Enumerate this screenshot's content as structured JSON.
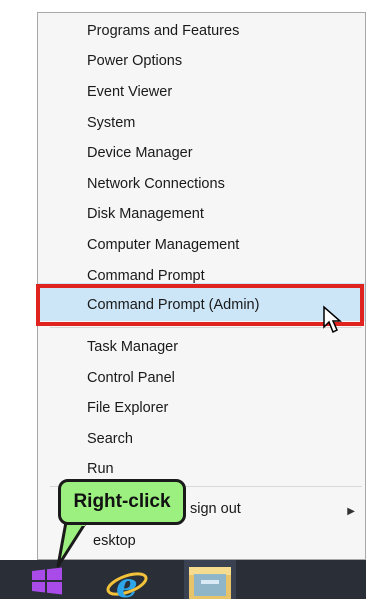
{
  "menu": {
    "items": [
      {
        "label": "Programs and Features"
      },
      {
        "label": "Power Options"
      },
      {
        "label": "Event Viewer"
      },
      {
        "label": "System"
      },
      {
        "label": "Device Manager"
      },
      {
        "label": "Network Connections"
      },
      {
        "label": "Disk Management"
      },
      {
        "label": "Computer Management"
      },
      {
        "label": "Command Prompt"
      },
      {
        "label": "Command Prompt (Admin)",
        "highlighted": true
      },
      {
        "label": "Task Manager"
      },
      {
        "label": "Control Panel"
      },
      {
        "label": "File Explorer"
      },
      {
        "label": "Search"
      },
      {
        "label": "Run"
      },
      {
        "label": "Shut down or sign out",
        "visible_label": "sign out",
        "has_submenu": true
      },
      {
        "label": "Desktop",
        "visible_label": "esktop"
      }
    ]
  },
  "callout": {
    "text": "Right-click"
  },
  "taskbar": {
    "icons": [
      "windows-start-icon",
      "internet-explorer-icon",
      "file-explorer-icon"
    ]
  },
  "colors": {
    "highlight_bg": "#cde6f7",
    "annotation_red": "#e0231e",
    "callout_green": "#9bf07f",
    "taskbar_bg": "#2a2e36"
  }
}
